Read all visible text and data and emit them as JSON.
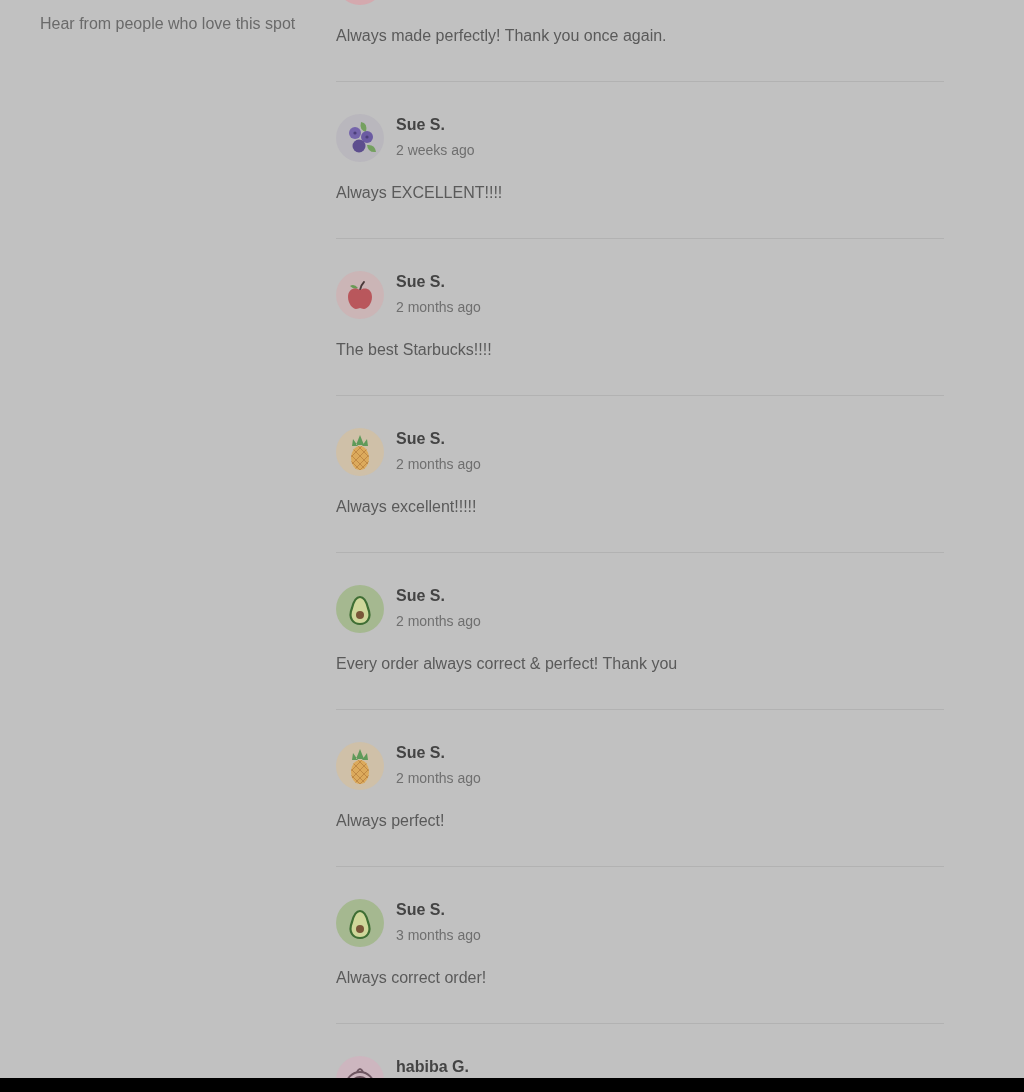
{
  "sidebar": {
    "subtitle": "Hear from people who love this spot"
  },
  "reviews": [
    {
      "kind": "tail",
      "avatar": {
        "kind": "plain"
      },
      "text": "Always made perfectly! Thank you once again."
    },
    {
      "kind": "full",
      "avatar": {
        "kind": "blueberry"
      },
      "name": "Sue S.",
      "date": "2 weeks ago",
      "text": "Always EXCELLENT!!!!"
    },
    {
      "kind": "full",
      "avatar": {
        "kind": "apple"
      },
      "name": "Sue S.",
      "date": "2 months ago",
      "text": "The best Starbucks!!!!"
    },
    {
      "kind": "full",
      "avatar": {
        "kind": "pineapple"
      },
      "name": "Sue S.",
      "date": "2 months ago",
      "text": "Always excellent!!!!!"
    },
    {
      "kind": "full",
      "avatar": {
        "kind": "avocado"
      },
      "name": "Sue S.",
      "date": "2 months ago",
      "text": "Every order always correct & perfect! Thank you"
    },
    {
      "kind": "full",
      "avatar": {
        "kind": "pineapple"
      },
      "name": "Sue S.",
      "date": "2 months ago",
      "text": "Always perfect!"
    },
    {
      "kind": "full",
      "avatar": {
        "kind": "avocado"
      },
      "name": "Sue S.",
      "date": "3 months ago",
      "text": "Always correct order!"
    },
    {
      "kind": "head",
      "avatar": {
        "kind": "rings"
      },
      "name": "habiba G."
    }
  ]
}
